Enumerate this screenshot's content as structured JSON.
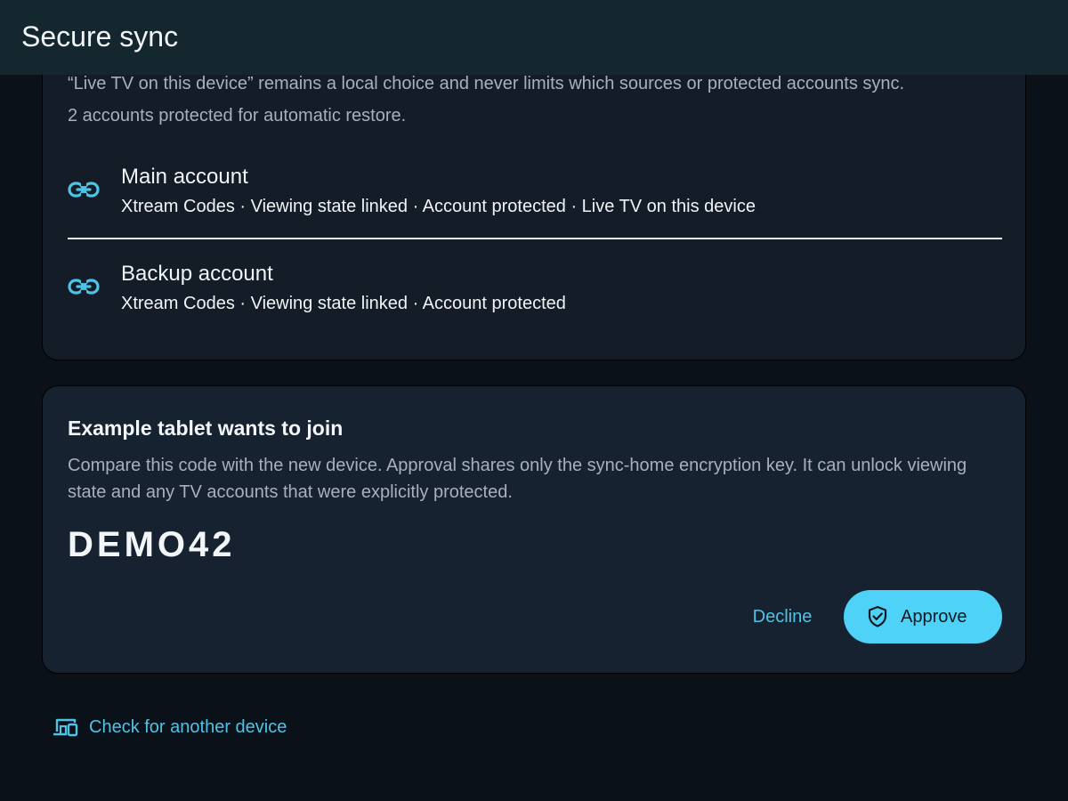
{
  "app_bar": {
    "title": "Secure sync"
  },
  "accounts_card": {
    "note_local_choice": "“Live TV on this device” remains a local choice and never limits which sources or protected accounts sync.",
    "note_protected_count": "2 accounts protected for automatic restore.",
    "accounts": [
      {
        "name": "Main account",
        "meta": "Xtream Codes · Viewing state linked · Account protected · Live TV on this device",
        "icon": "link-icon"
      },
      {
        "name": "Backup account",
        "meta": "Xtream Codes · Viewing state linked · Account protected",
        "icon": "link-icon"
      }
    ]
  },
  "join_card": {
    "title": "Example tablet wants to join",
    "description": "Compare this code with the new device. Approval shares only the sync-home encryption key. It can unlock viewing state and any TV accounts that were explicitly protected.",
    "code": "DEMO42",
    "decline_label": "Decline",
    "approve_label": "Approve",
    "approve_icon": "shield-check-icon"
  },
  "footer": {
    "check_device_label": "Check for another device",
    "check_device_icon": "devices-icon"
  },
  "colors": {
    "accent": "#4fd2f7",
    "link_text": "#4fc3e6",
    "background": "#0b1118",
    "app_bar": "#14262e",
    "card": "#131c27"
  }
}
